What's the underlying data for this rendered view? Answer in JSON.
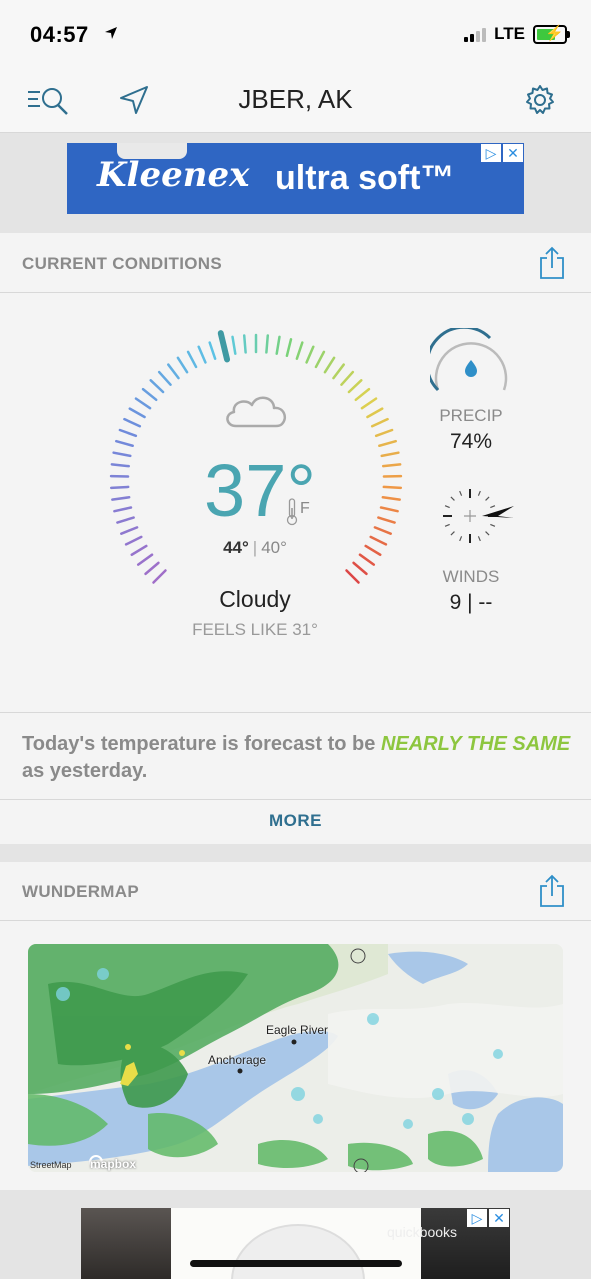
{
  "status_bar": {
    "time": "04:57",
    "network": "LTE"
  },
  "nav": {
    "title": "JBER, AK"
  },
  "ad_top": {
    "brand": "Kleenex",
    "tagline": "ultra soft™"
  },
  "current_conditions": {
    "section_label": "CURRENT CONDITIONS",
    "temperature": "37°",
    "unit": "F",
    "high": "44°",
    "separator": "|",
    "low": "40°",
    "condition": "Cloudy",
    "feels_like": "FEELS LIKE 31°",
    "precip_label": "PRECIP",
    "precip_value": "74%",
    "winds_label": "WINDS",
    "winds_value": "9 | --"
  },
  "summary": {
    "text_before": "Today's temperature is forecast to be ",
    "highlight": "NEARLY THE SAME",
    "text_after": " as yesterday."
  },
  "more_label": "MORE",
  "wundermap": {
    "section_label": "WUNDERMAP",
    "labels": {
      "anchorage": "Anchorage",
      "eagle_river": "Eagle River"
    },
    "credit": "StreetMap",
    "mapbox": "mapbox"
  },
  "ad_bottom": {
    "text": "quickbooks"
  },
  "colors": {
    "temp": "#4aa5b1",
    "highlight": "#8dc63f",
    "accent": "#2f6f8f",
    "ad_blue": "#2f66c3"
  }
}
